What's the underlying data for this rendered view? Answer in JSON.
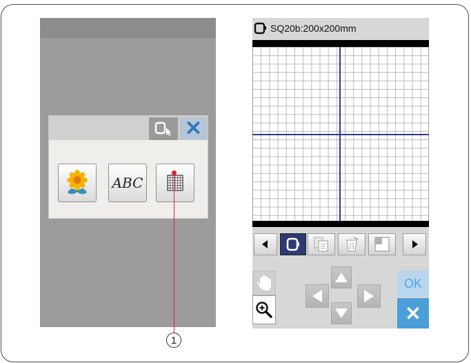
{
  "left_panel": {
    "dialog": {
      "close_glyph": "✕",
      "buttons": [
        {
          "name": "flower-design-button",
          "icon": "flower-icon"
        },
        {
          "name": "abc-lettering-button",
          "label": "ABC"
        },
        {
          "name": "grid-template-button",
          "icon": "grid-icon"
        }
      ]
    },
    "callout_number": "1"
  },
  "right_panel": {
    "hoop_title": "SQ20b:200x200mm",
    "ok_label": "OK",
    "close_glyph": "✕"
  },
  "colors": {
    "accent_blue": "#4a9fd8",
    "grid_center_line": "#2a3a8c",
    "callout_red": "#e02030"
  }
}
